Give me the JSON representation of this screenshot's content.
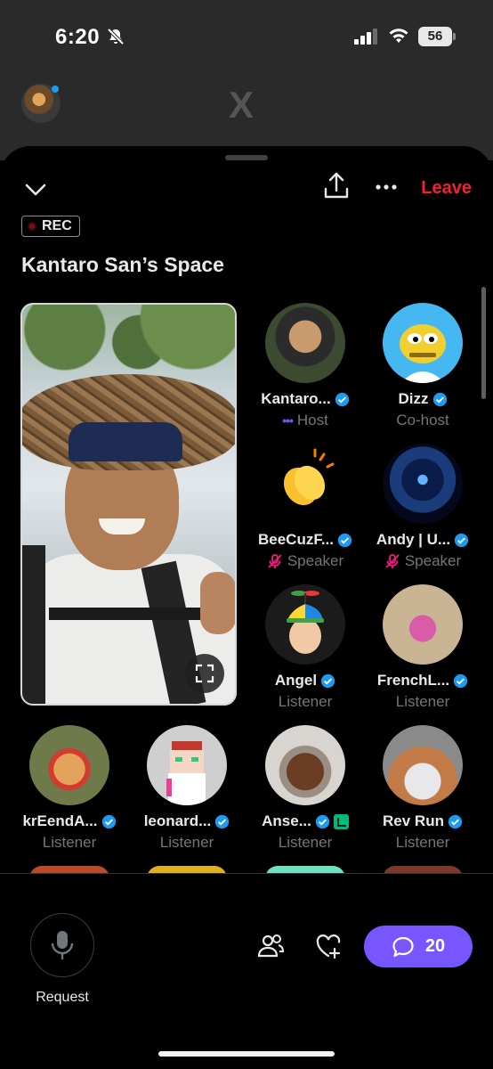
{
  "status_bar": {
    "time": "6:20",
    "battery": "56"
  },
  "background_app": {
    "logo": "X"
  },
  "header": {
    "leave_label": "Leave",
    "rec_label": "REC",
    "title": "Kantaro San’s Space"
  },
  "participants": [
    {
      "name": "Kantaro...",
      "role": "Host",
      "verified": true
    },
    {
      "name": "Dizz",
      "role": "Co-host",
      "verified": true
    },
    {
      "name": "BeeCuzF...",
      "role": "Speaker",
      "verified": true,
      "muted": true
    },
    {
      "name": "Andy | U...",
      "role": "Speaker",
      "verified": true,
      "muted": true
    },
    {
      "name": "Angel",
      "role": "Listener",
      "verified": true
    },
    {
      "name": "FrenchL...",
      "role": "Listener",
      "verified": true
    },
    {
      "name": "krEendA...",
      "role": "Listener",
      "verified": true
    },
    {
      "name": "leonard...",
      "role": "Listener",
      "verified": true
    },
    {
      "name": "Anse...",
      "role": "Listener",
      "verified": true,
      "extra_badge": "green-tag"
    },
    {
      "name": "Rev Run",
      "role": "Listener",
      "verified": true
    }
  ],
  "bottom_bar": {
    "request_label": "Request",
    "chat_count": "20"
  },
  "colors": {
    "accent": "#7856ff",
    "leave": "#f4212e",
    "verified": "#1d9bf0",
    "muted_mic": "#f91880",
    "muted_text": "#71767b"
  }
}
